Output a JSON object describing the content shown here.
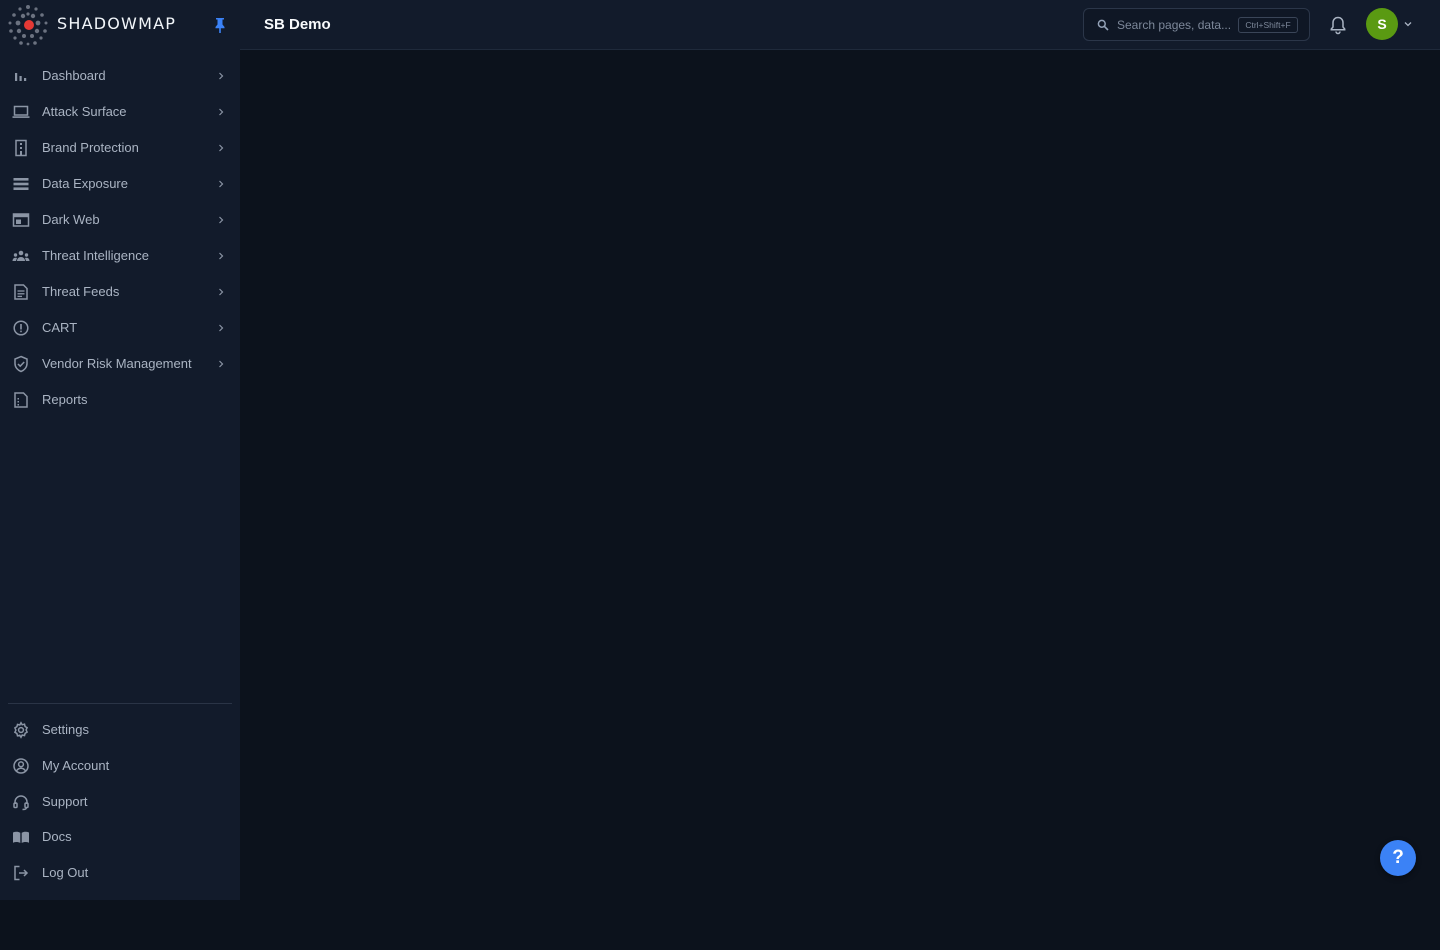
{
  "brand": {
    "name": "SHADOWMAP"
  },
  "header": {
    "title": "SB Demo",
    "search": {
      "placeholder": "Search pages, data...",
      "shortcut": "Ctrl+Shift+F"
    },
    "avatar_initial": "S"
  },
  "sidebar": {
    "items": [
      {
        "label": "Dashboard",
        "icon": "bar-chart-icon"
      },
      {
        "label": "Attack Surface",
        "icon": "laptop-icon"
      },
      {
        "label": "Brand Protection",
        "icon": "building-icon"
      },
      {
        "label": "Data Exposure",
        "icon": "database-list-icon"
      },
      {
        "label": "Dark Web",
        "icon": "web-window-icon"
      },
      {
        "label": "Threat Intelligence",
        "icon": "group-icon"
      },
      {
        "label": "Threat Feeds",
        "icon": "document-icon"
      },
      {
        "label": "CART",
        "icon": "alert-circle-icon"
      },
      {
        "label": "Vendor Risk Management",
        "icon": "shield-check-icon"
      },
      {
        "label": "Reports",
        "icon": "report-icon"
      }
    ],
    "bottom_items": [
      {
        "label": "Settings",
        "icon": "gear-icon"
      },
      {
        "label": "My Account",
        "icon": "account-circle-icon"
      },
      {
        "label": "Support",
        "icon": "headset-icon"
      },
      {
        "label": "Docs",
        "icon": "book-icon"
      },
      {
        "label": "Log Out",
        "icon": "logout-icon"
      }
    ]
  },
  "help_button": {
    "label": "?"
  },
  "colors": {
    "accent": "#3b82f6",
    "avatar": "#5a9a12",
    "logo_dot": "#e53935"
  }
}
